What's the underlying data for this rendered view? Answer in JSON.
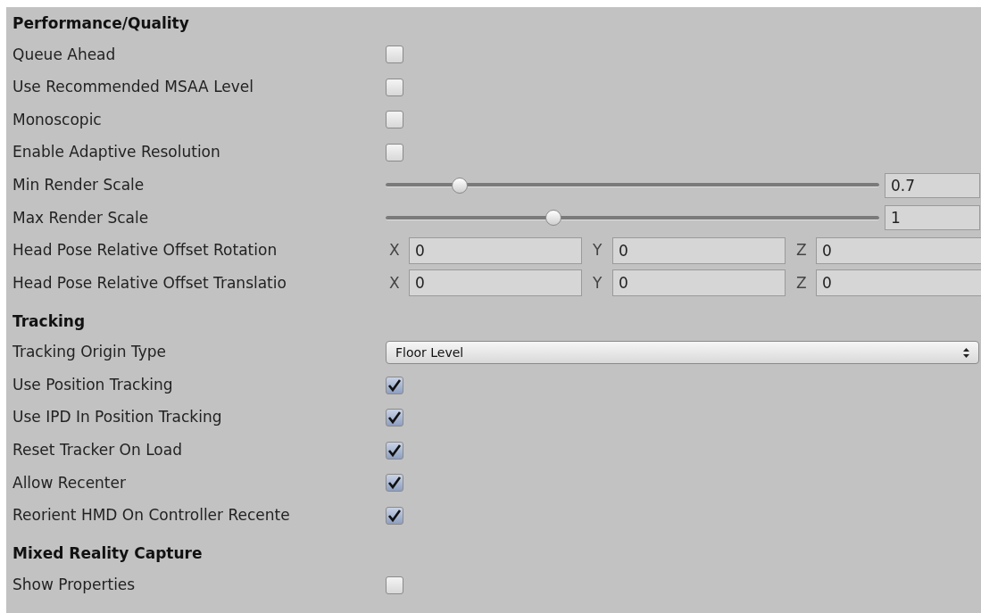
{
  "sections": [
    {
      "title": "Performance/Quality",
      "rows": [
        {
          "kind": "checkbox",
          "label": "Queue Ahead",
          "checked": false
        },
        {
          "kind": "checkbox",
          "label": "Use Recommended MSAA Level",
          "checked": false
        },
        {
          "kind": "checkbox",
          "label": "Monoscopic",
          "checked": false
        },
        {
          "kind": "checkbox",
          "label": "Enable Adaptive Resolution",
          "checked": false
        },
        {
          "kind": "slider",
          "label": "Min Render Scale",
          "level": 0.15,
          "value": "0.7"
        },
        {
          "kind": "slider",
          "label": "Max Render Scale",
          "level": 0.34,
          "value": "1"
        },
        {
          "kind": "vector3",
          "label": "Head Pose Relative Offset Rotation",
          "fields": [
            {
              "axis": "X",
              "value": "0"
            },
            {
              "axis": "Y",
              "value": "0"
            },
            {
              "axis": "Z",
              "value": "0"
            }
          ]
        },
        {
          "kind": "vector3",
          "label": "Head Pose Relative Offset Translatio",
          "fields": [
            {
              "axis": "X",
              "value": "0"
            },
            {
              "axis": "Y",
              "value": "0"
            },
            {
              "axis": "Z",
              "value": "0"
            }
          ]
        }
      ]
    },
    {
      "title": "Tracking",
      "rows": [
        {
          "kind": "dropdown",
          "label": "Tracking Origin Type",
          "value": "Floor Level"
        },
        {
          "kind": "checkbox",
          "label": "Use Position Tracking",
          "checked": true
        },
        {
          "kind": "checkbox",
          "label": "Use IPD In Position Tracking",
          "checked": true
        },
        {
          "kind": "checkbox",
          "label": "Reset Tracker On Load",
          "checked": true
        },
        {
          "kind": "checkbox",
          "label": "Allow Recenter",
          "checked": true
        },
        {
          "kind": "checkbox",
          "label": "Reorient HMD On Controller Recente",
          "checked": true
        }
      ]
    },
    {
      "title": "Mixed Reality Capture",
      "rows": [
        {
          "kind": "checkbox",
          "label": "Show Properties",
          "checked": false
        }
      ]
    }
  ]
}
